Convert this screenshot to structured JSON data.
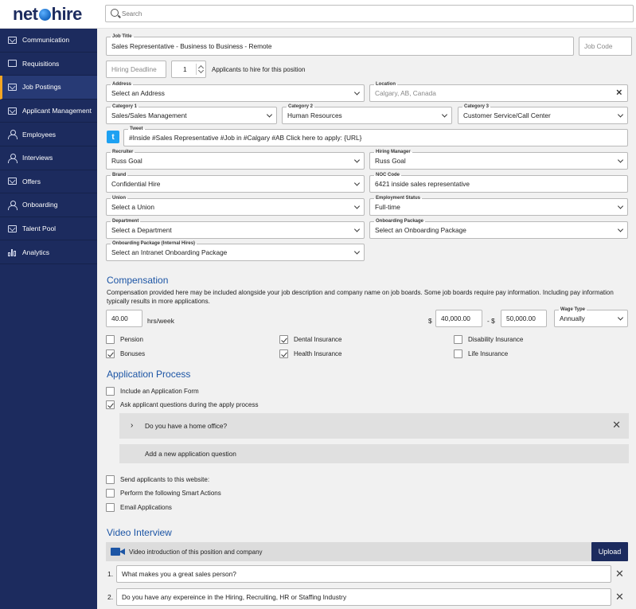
{
  "brand": {
    "logo_part1": "net",
    "logo_part2": "hire"
  },
  "search": {
    "placeholder": "Search"
  },
  "sidebar": {
    "items": [
      {
        "label": "Communication",
        "icon": "envelope-icon"
      },
      {
        "label": "Requisitions",
        "icon": "list-icon"
      },
      {
        "label": "Job Postings",
        "icon": "envelope-icon",
        "active": true
      },
      {
        "label": "Applicant Management",
        "icon": "envelope-icon"
      },
      {
        "label": "Employees",
        "icon": "person-icon"
      },
      {
        "label": "Interviews",
        "icon": "people-icon"
      },
      {
        "label": "Offers",
        "icon": "envelope-icon"
      },
      {
        "label": "Onboarding",
        "icon": "person-add-icon"
      },
      {
        "label": "Talent Pool",
        "icon": "envelope-icon"
      },
      {
        "label": "Analytics",
        "icon": "bar-chart-icon"
      }
    ]
  },
  "form": {
    "job_title": {
      "label": "Job Title",
      "value": "Sales Representative  - Business to Business - Remote"
    },
    "job_code": {
      "placeholder": "Job Code"
    },
    "hiring_deadline": {
      "placeholder": "Hiring Deadline"
    },
    "applicants": {
      "value": "1",
      "suffix": "Applicants to hire for this position"
    },
    "address": {
      "label": "Address",
      "value": "Select an Address"
    },
    "location": {
      "label": "Location",
      "placeholder": "Calgary, AB, Canada"
    },
    "category1": {
      "label": "Category 1",
      "value": "Sales/Sales Management"
    },
    "category2": {
      "label": "Category 2",
      "value": "Human Resources"
    },
    "category3": {
      "label": "Category 3",
      "value": "Customer Service/Call Center"
    },
    "tweet": {
      "label": "Tweet",
      "value": "#Inside #Sales Representative #Job in #Calgary #AB Click here to apply: {URL}"
    },
    "recruiter": {
      "label": "Recruiter",
      "value": "Russ Goal"
    },
    "hiring_manager": {
      "label": "Hiring Manager",
      "value": "Russ Goal"
    },
    "brand": {
      "label": "Brand",
      "value": "Confidential Hire"
    },
    "noc_code": {
      "label": "NOC Code",
      "value": "6421 inside sales representative"
    },
    "union": {
      "label": "Union",
      "value": "Select a Union"
    },
    "employment_status": {
      "label": "Employment Status",
      "value": "Full-time"
    },
    "department": {
      "label": "Department",
      "value": "Select a Department"
    },
    "onboarding_package": {
      "label": "Onboarding Package",
      "value": "Select an Onboarding Package"
    },
    "onboarding_internal": {
      "label": "Onboarding Package (Internal Hires)",
      "value": "Select an Intranet Onboarding Package"
    }
  },
  "compensation": {
    "title": "Compensation",
    "description": "Compensation provided here may be included alongside your job description and company name on job boards. Some job boards require pay information. Including pay information typically results in more applications.",
    "hours": "40.00",
    "hours_unit": "hrs/week",
    "currency": "$",
    "range_sep": "- $",
    "min": "40,000.00",
    "max": "50,000.00",
    "wage_type": {
      "label": "Wage Type",
      "value": "Annually"
    },
    "benefits": [
      {
        "label": "Pension",
        "checked": false
      },
      {
        "label": "Dental Insurance",
        "checked": true
      },
      {
        "label": "Disability Insurance",
        "checked": false
      },
      {
        "label": "Bonuses",
        "checked": true
      },
      {
        "label": "Health Insurance",
        "checked": true
      },
      {
        "label": "Life Insurance",
        "checked": false
      }
    ]
  },
  "application": {
    "title": "Application Process",
    "include_form": "Include an Application Form",
    "ask_questions": "Ask applicant questions during the apply process",
    "question": "Do you have a home office?",
    "add_question": "Add a new application question",
    "send_to_website": "Send applicants to this website:",
    "smart_actions": "Perform the following Smart Actions",
    "email_apps": "Email Applications"
  },
  "video": {
    "title": "Video Interview",
    "intro": "Video introduction of this position and company",
    "upload": "Upload",
    "questions": [
      {
        "num": "1.",
        "text": "What makes you a great sales person?"
      },
      {
        "num": "2.",
        "text": "Do you have any expereince in the Hiring, Recruiting, HR or Staffing Industry"
      }
    ]
  }
}
